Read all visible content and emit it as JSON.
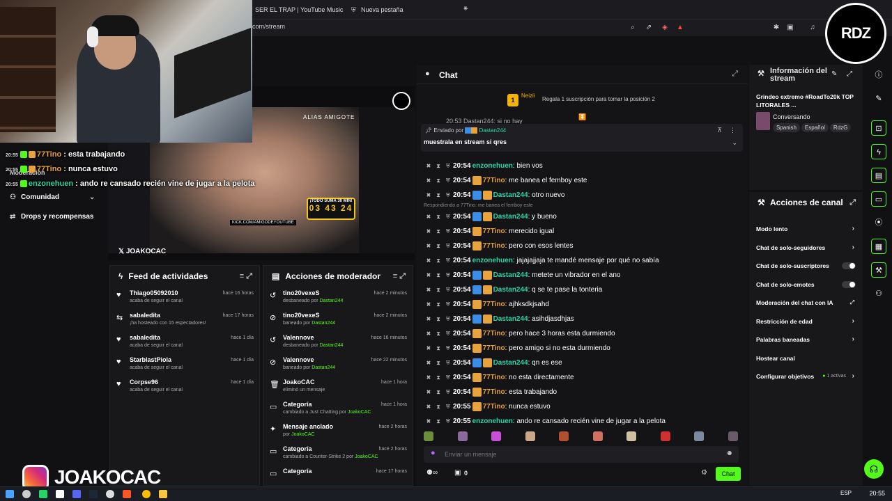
{
  "browser": {
    "tabs": [
      "SER EL TRAP | YouTube Music",
      "Nueva pestaña"
    ],
    "new_tab": "+",
    "url": "com/stream"
  },
  "overlay_chat": [
    {
      "time": "20:55",
      "user": "77Tino",
      "text": ": esta trabajando"
    },
    {
      "time": "20:55",
      "user": "77Tino",
      "text": ": nunca estuvo"
    },
    {
      "time": "20:55",
      "user": "enzonehuen",
      "text": ": ando re cansado recién vine de jugar a la pelota"
    }
  ],
  "left_nav": [
    "Moderación",
    "Comunidad",
    "Drops y recompensas"
  ],
  "preview": {
    "alias": "ALIAS AMIGOTE",
    "timer_title": "¡TODO SUMA 30 MIN!",
    "timer_value": "03 43 24",
    "url": "KICK.COM/AMIGODEYOUTUBE",
    "tag": "JOAKOCAC"
  },
  "feed": {
    "title": "Feed de actividades",
    "items": [
      {
        "name": "Thiago05092010",
        "sub": "acaba de seguir el canal",
        "time": "hace 16 horas",
        "icon": "heart-icon"
      },
      {
        "name": "sabaledita",
        "sub": "¡ha hosteado con 15 espectadores!",
        "time": "hace 17 horas",
        "icon": "host-icon"
      },
      {
        "name": "sabaledita",
        "sub": "acaba de seguir el canal",
        "time": "hace 1 día",
        "icon": "heart-icon"
      },
      {
        "name": "StarblastPiola",
        "sub": "acaba de seguir el canal",
        "time": "hace 1 día",
        "icon": "heart-icon"
      },
      {
        "name": "Corpse96",
        "sub": "acaba de seguir el canal",
        "time": "hace 1 día",
        "icon": "heart-icon"
      }
    ]
  },
  "mod_actions": {
    "title": "Acciones de moderador",
    "items": [
      {
        "name": "tino20vexeS",
        "sub": "desbaneado por",
        "by": "Dastan244",
        "time": "hace 2 minutos"
      },
      {
        "name": "tino20vexeS",
        "sub": "baneado por",
        "by": "Dastan244",
        "time": "hace 2 minutos"
      },
      {
        "name": "Valennove",
        "sub": "desbaneado por",
        "by": "Dastan244",
        "time": "hace 16 minutos"
      },
      {
        "name": "Valennove",
        "sub": "baneado por",
        "by": "Dastan244",
        "time": "hace 22 minutos"
      },
      {
        "name": "JoakoCAC",
        "sub": "eliminó un mensaje",
        "by": "",
        "time": "hace 1 hora"
      },
      {
        "name": "Categoría",
        "sub": "cambiado a Just Chatting por",
        "by": "JoakoCAC",
        "time": "hace 1 hora"
      },
      {
        "name": "Mensaje anclado",
        "sub": "por",
        "by": "JoakoCAC",
        "time": "hace 2 horas"
      },
      {
        "name": "Categoría",
        "sub": "cambiado a Counter-Strike 2 por",
        "by": "JoakoCAC",
        "time": "hace 2 horas"
      },
      {
        "name": "Categoría",
        "sub": "",
        "by": "",
        "time": "hace 17 horas"
      }
    ]
  },
  "chat": {
    "title": "Chat",
    "gift": {
      "rank": "1",
      "name": "Neizii",
      "text": "Regala 1 suscripción para tomar la posición 2"
    },
    "top_partial": "20:53 Dastan244: si no hay",
    "pinned_label": "Enviado por",
    "pinned_user": "Dastan244",
    "pinned_msg": "muestrala en stream si qres",
    "reply_note": "Respondiendo a 77Tino: me banea el femboy este",
    "messages": [
      {
        "time": "20:54",
        "user": "enzonehuen",
        "badge": "none",
        "text": ": bien vos"
      },
      {
        "time": "20:54",
        "user": "77Tino",
        "badge": "gold",
        "text": ": me banea el femboy este"
      },
      {
        "time": "20:54",
        "user": "Dastan244",
        "badge": "blue",
        "text": ": otro nuevo"
      },
      {
        "time": "20:54",
        "user": "Dastan244",
        "badge": "blue",
        "text": ": y bueno"
      },
      {
        "time": "20:54",
        "user": "77Tino",
        "badge": "gold",
        "text": ": merecido igual"
      },
      {
        "time": "20:54",
        "user": "77Tino",
        "badge": "gold",
        "text": ": pero con esos lentes"
      },
      {
        "time": "20:54",
        "user": "enzonehuen",
        "badge": "none",
        "text": ": jajajajjaja te mandé mensaje por qué no sabía"
      },
      {
        "time": "20:54",
        "user": "Dastan244",
        "badge": "blue",
        "text": ": metete un vibrador en el ano"
      },
      {
        "time": "20:54",
        "user": "Dastan244",
        "badge": "blue",
        "text": ": q se te pase la tonteria"
      },
      {
        "time": "20:54",
        "user": "77Tino",
        "badge": "gold",
        "text": ": ajhksdkjsahd"
      },
      {
        "time": "20:54",
        "user": "Dastan244",
        "badge": "blue",
        "text": ": asihdjasdhjas"
      },
      {
        "time": "20:54",
        "user": "77Tino",
        "badge": "gold",
        "text": ": pero hace 3 horas esta durmiendo"
      },
      {
        "time": "20:54",
        "user": "77Tino",
        "badge": "gold",
        "text": ": pero amigo si no esta durmiendo"
      },
      {
        "time": "20:54",
        "user": "Dastan244",
        "badge": "blue",
        "text": ": qn es ese"
      },
      {
        "time": "20:54",
        "user": "77Tino",
        "badge": "gold",
        "text": ": no esta directamente"
      },
      {
        "time": "20:54",
        "user": "77Tino",
        "badge": "gold",
        "text": ": esta trabajando"
      },
      {
        "time": "20:55",
        "user": "77Tino",
        "badge": "gold",
        "text": ": nunca estuvo"
      },
      {
        "time": "20:55",
        "user": "enzonehuen",
        "badge": "none",
        "text": ": ando re cansado recién vine de jugar a la pelota"
      }
    ],
    "input_placeholder": "Enviar un mensaje",
    "viewers": "0",
    "send_label": "Chat"
  },
  "stream_info": {
    "title": "Información del stream",
    "stream_title": "Grindeo extremo #RoadTo20k TOP LITORALES ...",
    "category": "Conversando",
    "tags": [
      "Spanish",
      "Español",
      "RdzG"
    ]
  },
  "channel_actions": {
    "title": "Acciones de canal",
    "items": [
      {
        "label": "Modo lento",
        "control": "arrow"
      },
      {
        "label": "Chat de solo-seguidores",
        "control": "arrow"
      },
      {
        "label": "Chat de solo-suscriptores",
        "control": "toggle"
      },
      {
        "label": "Chat de solo-emotes",
        "control": "toggle"
      },
      {
        "label": "Moderación del chat con IA",
        "control": "external"
      },
      {
        "label": "Restricción de edad",
        "control": "arrow"
      },
      {
        "label": "Palabras baneadas",
        "control": "arrow"
      },
      {
        "label": "Hostear canal",
        "control": "none"
      },
      {
        "label": "Configurar objetivos",
        "control": "arrow",
        "extra": "1 activas"
      }
    ]
  },
  "logo_text": "RDZ",
  "instagram": "JOAKOCAC",
  "taskbar": {
    "lang": "ESP",
    "time": "20:55"
  },
  "colors": {
    "accent": "#53fc18",
    "gold": "#e8a33c",
    "blue": "#3a8ee6",
    "teal": "#2bd6a6",
    "bg": "#111113",
    "panel": "#18181b"
  }
}
